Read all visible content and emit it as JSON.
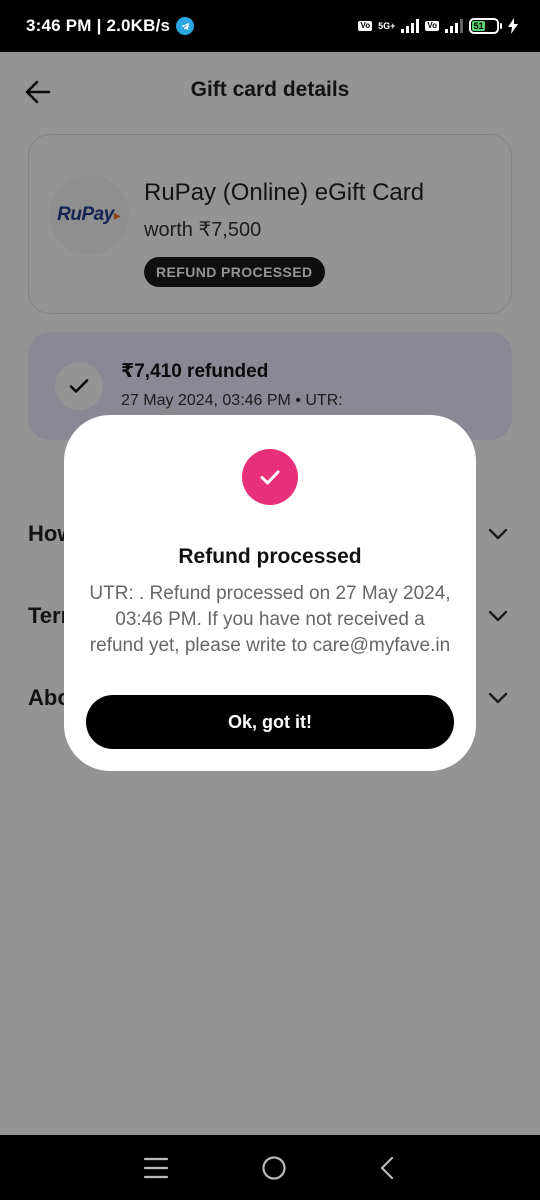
{
  "status_bar": {
    "time": "3:46 PM | 2.0KB/s",
    "net_badge_1": "Vo\nNR",
    "net_type": "5G+",
    "net_badge_2": "Vo\nLTE",
    "battery": "51"
  },
  "header": {
    "title": "Gift card details"
  },
  "gift_card": {
    "logo_text": "RuPay",
    "title": "RuPay (Online) eGift Card",
    "worth": "worth ₹7,500",
    "status_badge": "REFUND PROCESSED"
  },
  "refund": {
    "amount": "₹7,410 refunded",
    "meta": "27 May 2024, 03:46 PM • UTR:"
  },
  "accordions": [
    {
      "label": "How to redeem"
    },
    {
      "label": "Terms & conditions"
    },
    {
      "label": "About the brand"
    }
  ],
  "dialog": {
    "title": "Refund processed",
    "message": "UTR: . Refund processed on 27 May 2024, 03:46 PM. If you have not received a refund yet, please write to care@myfave.in",
    "button": "Ok, got it!"
  },
  "colors": {
    "accent": "#e8307a",
    "refund_bg": "#eeeafc",
    "button_bg": "#000000"
  }
}
